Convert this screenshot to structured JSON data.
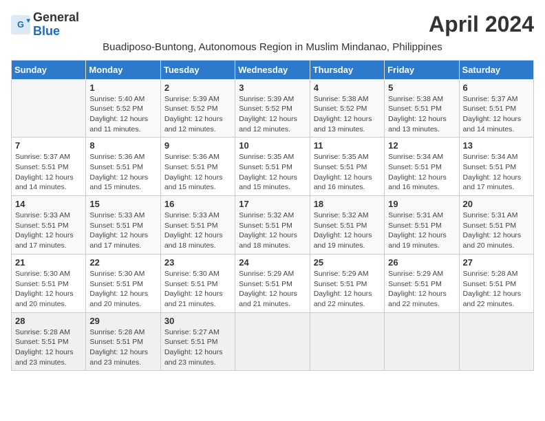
{
  "header": {
    "logo_general": "General",
    "logo_blue": "Blue",
    "title": "April 2024",
    "subtitle": "Buadiposo-Buntong, Autonomous Region in Muslim Mindanao, Philippines"
  },
  "weekdays": [
    "Sunday",
    "Monday",
    "Tuesday",
    "Wednesday",
    "Thursday",
    "Friday",
    "Saturday"
  ],
  "weeks": [
    [
      {
        "day": "",
        "info": ""
      },
      {
        "day": "1",
        "info": "Sunrise: 5:40 AM\nSunset: 5:52 PM\nDaylight: 12 hours\nand 11 minutes."
      },
      {
        "day": "2",
        "info": "Sunrise: 5:39 AM\nSunset: 5:52 PM\nDaylight: 12 hours\nand 12 minutes."
      },
      {
        "day": "3",
        "info": "Sunrise: 5:39 AM\nSunset: 5:52 PM\nDaylight: 12 hours\nand 12 minutes."
      },
      {
        "day": "4",
        "info": "Sunrise: 5:38 AM\nSunset: 5:52 PM\nDaylight: 12 hours\nand 13 minutes."
      },
      {
        "day": "5",
        "info": "Sunrise: 5:38 AM\nSunset: 5:51 PM\nDaylight: 12 hours\nand 13 minutes."
      },
      {
        "day": "6",
        "info": "Sunrise: 5:37 AM\nSunset: 5:51 PM\nDaylight: 12 hours\nand 14 minutes."
      }
    ],
    [
      {
        "day": "7",
        "info": "Sunrise: 5:37 AM\nSunset: 5:51 PM\nDaylight: 12 hours\nand 14 minutes."
      },
      {
        "day": "8",
        "info": "Sunrise: 5:36 AM\nSunset: 5:51 PM\nDaylight: 12 hours\nand 15 minutes."
      },
      {
        "day": "9",
        "info": "Sunrise: 5:36 AM\nSunset: 5:51 PM\nDaylight: 12 hours\nand 15 minutes."
      },
      {
        "day": "10",
        "info": "Sunrise: 5:35 AM\nSunset: 5:51 PM\nDaylight: 12 hours\nand 15 minutes."
      },
      {
        "day": "11",
        "info": "Sunrise: 5:35 AM\nSunset: 5:51 PM\nDaylight: 12 hours\nand 16 minutes."
      },
      {
        "day": "12",
        "info": "Sunrise: 5:34 AM\nSunset: 5:51 PM\nDaylight: 12 hours\nand 16 minutes."
      },
      {
        "day": "13",
        "info": "Sunrise: 5:34 AM\nSunset: 5:51 PM\nDaylight: 12 hours\nand 17 minutes."
      }
    ],
    [
      {
        "day": "14",
        "info": "Sunrise: 5:33 AM\nSunset: 5:51 PM\nDaylight: 12 hours\nand 17 minutes."
      },
      {
        "day": "15",
        "info": "Sunrise: 5:33 AM\nSunset: 5:51 PM\nDaylight: 12 hours\nand 17 minutes."
      },
      {
        "day": "16",
        "info": "Sunrise: 5:33 AM\nSunset: 5:51 PM\nDaylight: 12 hours\nand 18 minutes."
      },
      {
        "day": "17",
        "info": "Sunrise: 5:32 AM\nSunset: 5:51 PM\nDaylight: 12 hours\nand 18 minutes."
      },
      {
        "day": "18",
        "info": "Sunrise: 5:32 AM\nSunset: 5:51 PM\nDaylight: 12 hours\nand 19 minutes."
      },
      {
        "day": "19",
        "info": "Sunrise: 5:31 AM\nSunset: 5:51 PM\nDaylight: 12 hours\nand 19 minutes."
      },
      {
        "day": "20",
        "info": "Sunrise: 5:31 AM\nSunset: 5:51 PM\nDaylight: 12 hours\nand 20 minutes."
      }
    ],
    [
      {
        "day": "21",
        "info": "Sunrise: 5:30 AM\nSunset: 5:51 PM\nDaylight: 12 hours\nand 20 minutes."
      },
      {
        "day": "22",
        "info": "Sunrise: 5:30 AM\nSunset: 5:51 PM\nDaylight: 12 hours\nand 20 minutes."
      },
      {
        "day": "23",
        "info": "Sunrise: 5:30 AM\nSunset: 5:51 PM\nDaylight: 12 hours\nand 21 minutes."
      },
      {
        "day": "24",
        "info": "Sunrise: 5:29 AM\nSunset: 5:51 PM\nDaylight: 12 hours\nand 21 minutes."
      },
      {
        "day": "25",
        "info": "Sunrise: 5:29 AM\nSunset: 5:51 PM\nDaylight: 12 hours\nand 22 minutes."
      },
      {
        "day": "26",
        "info": "Sunrise: 5:29 AM\nSunset: 5:51 PM\nDaylight: 12 hours\nand 22 minutes."
      },
      {
        "day": "27",
        "info": "Sunrise: 5:28 AM\nSunset: 5:51 PM\nDaylight: 12 hours\nand 22 minutes."
      }
    ],
    [
      {
        "day": "28",
        "info": "Sunrise: 5:28 AM\nSunset: 5:51 PM\nDaylight: 12 hours\nand 23 minutes."
      },
      {
        "day": "29",
        "info": "Sunrise: 5:28 AM\nSunset: 5:51 PM\nDaylight: 12 hours\nand 23 minutes."
      },
      {
        "day": "30",
        "info": "Sunrise: 5:27 AM\nSunset: 5:51 PM\nDaylight: 12 hours\nand 23 minutes."
      },
      {
        "day": "",
        "info": ""
      },
      {
        "day": "",
        "info": ""
      },
      {
        "day": "",
        "info": ""
      },
      {
        "day": "",
        "info": ""
      }
    ]
  ]
}
